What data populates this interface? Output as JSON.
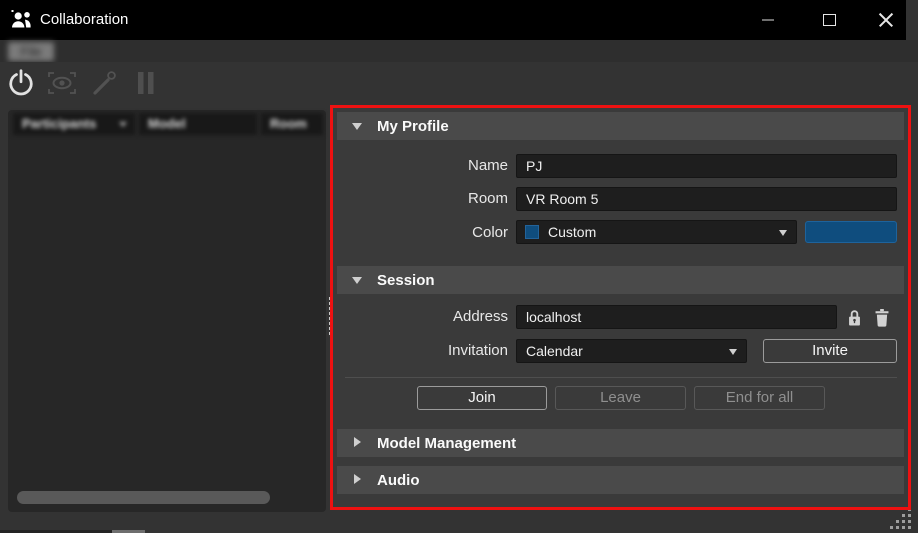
{
  "window": {
    "title": "Collaboration"
  },
  "menu": {
    "file_label": "File"
  },
  "toolbar": {
    "buttons": [
      {
        "icon": "power-icon",
        "enabled": true
      },
      {
        "icon": "eye-scan-icon",
        "enabled": false
      },
      {
        "icon": "pointer-wand-icon",
        "enabled": false
      },
      {
        "icon": "pause-icon",
        "enabled": false
      }
    ]
  },
  "participants_table": {
    "columns": [
      "Participants",
      "Model",
      "Room"
    ],
    "rows": []
  },
  "my_profile": {
    "header": "My Profile",
    "name_label": "Name",
    "name_value": "PJ",
    "room_label": "Room",
    "room_value": "VR Room 5",
    "color_label": "Color",
    "color_selected": "Custom",
    "custom_color": "#0f4d7e"
  },
  "session": {
    "header": "Session",
    "address_label": "Address",
    "address_value": "localhost",
    "invitation_label": "Invitation",
    "invitation_selected": "Calendar",
    "invite_button": "Invite",
    "join_button": "Join",
    "leave_button": "Leave",
    "end_for_all_button": "End for all"
  },
  "model_management": {
    "header": "Model Management"
  },
  "audio": {
    "header": "Audio"
  },
  "colors": {
    "custom_swatch": "#0f4d7e",
    "annotation_red": "#ee1111"
  }
}
